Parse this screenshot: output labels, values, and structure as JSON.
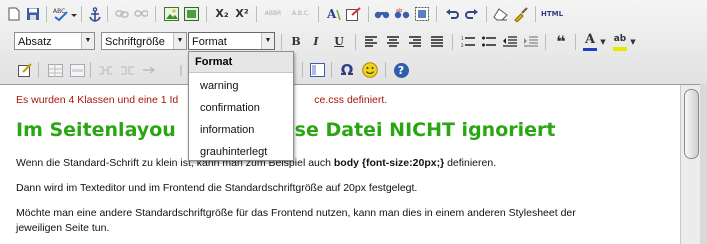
{
  "toolbar": {
    "paragraph_combo": "Absatz",
    "fontsize_combo": "Schriftgröße",
    "format_combo": "Format",
    "abbr_label": "ABBR",
    "acronym_label": "A.B.C.",
    "html_label": "HTML",
    "bold_label": "B",
    "italic_label": "I",
    "underline_label": "U",
    "subscript_label": "X₂",
    "superscript_label": "X²",
    "omega_label": "Ω",
    "help_label": "?",
    "quote_label": "❝",
    "textcolor_label": "A",
    "bgcolor_label": "ab",
    "colors": {
      "textcolor_bar": "#1f3fbf",
      "bgcolor_bar": "#e8e800",
      "smiley": "#f3d21a",
      "help": "#2f5fa8"
    }
  },
  "format_dropdown": {
    "header": "Format",
    "items": [
      "warning",
      "confirmation",
      "information",
      "grauhinterlegt"
    ]
  },
  "content": {
    "notice_start": "Es wurden 4 Klassen und eine 1 Id",
    "notice_end": "ce.css definiert.",
    "heading_start": "Im Seitenlayou",
    "heading_end": "ese Datei NICHT ignoriert",
    "p1_start": "Wenn die Standard-Schrift zu klein ist, kann man zum Beispiel auch ",
    "p1_bold": "body {font-size:20px;}",
    "p1_end": " definieren.",
    "p2": "Dann wird im Texteditor und im Frontend die Standardschriftgröße auf 20px festgelegt.",
    "p3_line1": "Möchte man eine andere Standardschriftgröße für das Frontend nutzen, kann man dies in einem anderen Stylesheet der",
    "p3_line2": "jeweiligen Seite tun.",
    "colors": {
      "notice": "#a8160c",
      "heading": "#2aa612"
    }
  }
}
